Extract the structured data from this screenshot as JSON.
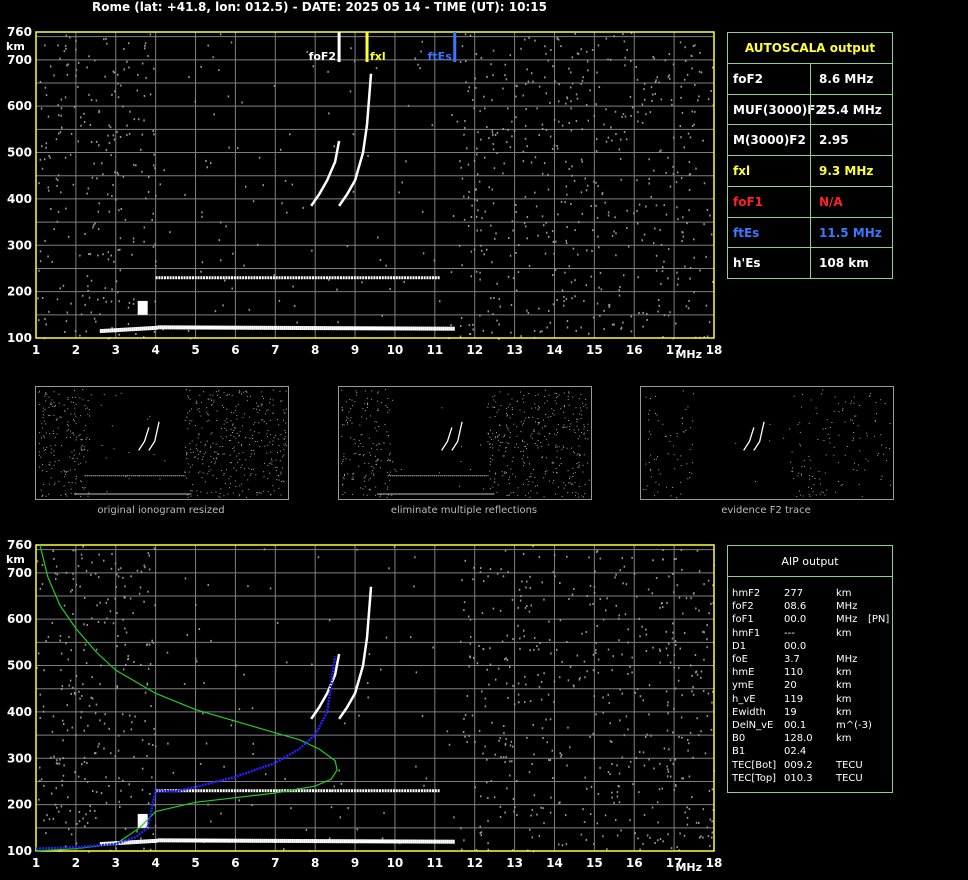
{
  "header": {
    "title": "Rome (lat: +41.8, lon: 012.5) - DATE: 2025 05 14 - TIME (UT): 10:15"
  },
  "colors": {
    "grid": "#7f7f7f",
    "axis_frame": "#ffff33",
    "trace": "#ffffff",
    "fof2": "#ffffff",
    "fxl": "#ffff33",
    "ftes": "#3a78ff",
    "panel_border": "#8fd08f",
    "profile": "#22cc22",
    "model_trace": "#2222ff"
  },
  "chart_data": [
    {
      "type": "scatter",
      "name_key": "autoscala-ionogram",
      "xlabel": "MHz",
      "ylabel": "km",
      "xlim": [
        1,
        18
      ],
      "ylim": [
        100,
        760
      ],
      "x_ticks": [
        "1",
        "2",
        "3",
        "4",
        "5",
        "6",
        "7",
        "8",
        "9",
        "10",
        "11",
        "12",
        "13",
        "14",
        "15",
        "16",
        "17",
        "18"
      ],
      "y_ticks": [
        "100",
        "200",
        "300",
        "400",
        "500",
        "600",
        "700",
        "760"
      ],
      "markers": [
        {
          "label": "foF2",
          "x": 8.6,
          "color": "#ffffff"
        },
        {
          "label": "fxl",
          "x": 9.3,
          "color": "#ffff33"
        },
        {
          "label": "ftEs",
          "x": 11.5,
          "color": "#3a78ff"
        }
      ],
      "traces": {
        "es_layer": {
          "x": [
            2.6,
            11.5
          ],
          "y": [
            115,
            125
          ]
        },
        "e_cusp": {
          "x": [
            3.55,
            3.8
          ],
          "y": [
            150,
            180
          ]
        },
        "f1_flat": {
          "x": [
            4.0,
            11.1
          ],
          "y": [
            230,
            230
          ]
        },
        "f2_ordinary": {
          "x": [
            7.9,
            8.1,
            8.3,
            8.5,
            8.6
          ],
          "y": [
            385,
            410,
            440,
            480,
            525
          ]
        },
        "f2_extraordinary": {
          "x": [
            8.6,
            8.8,
            9.0,
            9.2,
            9.3,
            9.4
          ],
          "y": [
            385,
            410,
            440,
            500,
            560,
            670
          ]
        }
      }
    },
    {
      "type": "scatter",
      "name_key": "aip-ionogram",
      "xlabel": "MHz",
      "ylabel": "km",
      "xlim": [
        1,
        18
      ],
      "ylim": [
        100,
        760
      ],
      "x_ticks": [
        "1",
        "2",
        "3",
        "4",
        "5",
        "6",
        "7",
        "8",
        "9",
        "10",
        "11",
        "12",
        "13",
        "14",
        "15",
        "16",
        "17",
        "18"
      ],
      "y_ticks": [
        "100",
        "200",
        "300",
        "400",
        "500",
        "600",
        "700",
        "760"
      ],
      "profile_curve": {
        "x": [
          1.1,
          1.3,
          1.6,
          2.0,
          2.5,
          3.0,
          4.0,
          5.0,
          6.0,
          7.0,
          7.6,
          8.1,
          8.5,
          8.55,
          8.4,
          8.0,
          7.0,
          6.0,
          5.0,
          4.0,
          3.6,
          3.0,
          2.0,
          1.0
        ],
        "y": [
          760,
          690,
          630,
          580,
          530,
          490,
          440,
          405,
          380,
          355,
          340,
          320,
          295,
          275,
          255,
          240,
          225,
          215,
          205,
          185,
          150,
          115,
          105,
          100
        ]
      },
      "model_trace": {
        "x": [
          1.0,
          2.0,
          3.0,
          3.5,
          3.8,
          4.0,
          4.5,
          5.0,
          6.0,
          7.0,
          7.6,
          8.0,
          8.3,
          8.5
        ],
        "y": [
          105,
          108,
          115,
          130,
          150,
          230,
          228,
          238,
          260,
          290,
          320,
          350,
          400,
          520
        ]
      }
    }
  ],
  "autoscala": {
    "title": "AUTOSCALA output",
    "rows": [
      {
        "label": "foF2",
        "value": "8.6 MHz",
        "color": "#ffffff"
      },
      {
        "label": "MUF(3000)F2",
        "value": "25.4 MHz",
        "color": "#ffffff"
      },
      {
        "label": "M(3000)F2",
        "value": "2.95",
        "color": "#ffffff"
      },
      {
        "label": "fxl",
        "value": "9.3 MHz",
        "color": "#ffff33"
      },
      {
        "label": "foF1",
        "value": "N/A",
        "color": "#ff2222"
      },
      {
        "label": "ftEs",
        "value": "11.5 MHz",
        "color": "#3a78ff"
      },
      {
        "label": "h'Es",
        "value": "108     km",
        "color": "#ffffff"
      }
    ]
  },
  "thumbnails": [
    {
      "caption": "original ionogram resized"
    },
    {
      "caption": "eliminate multiple reflections"
    },
    {
      "caption": "evidence F2 trace"
    }
  ],
  "aip": {
    "title": "AIP output",
    "rows": [
      {
        "k": "hmF2",
        "v": "277",
        "u": "km",
        "e": ""
      },
      {
        "k": "foF2",
        "v": "08.6",
        "u": "MHz",
        "e": ""
      },
      {
        "k": "foF1",
        "v": "00.0",
        "u": "MHz",
        "e": "[PN]"
      },
      {
        "k": "hmF1",
        "v": "---",
        "u": "km",
        "e": ""
      },
      {
        "k": "D1",
        "v": "00.0",
        "u": "",
        "e": ""
      },
      {
        "k": "foE",
        "v": "3.7",
        "u": "MHz",
        "e": ""
      },
      {
        "k": "hmE",
        "v": "110",
        "u": "km",
        "e": ""
      },
      {
        "k": "ymE",
        "v": "20",
        "u": "km",
        "e": ""
      },
      {
        "k": "h_vE",
        "v": "119",
        "u": "km",
        "e": ""
      },
      {
        "k": "Ewidth",
        "v": "19",
        "u": "km",
        "e": ""
      },
      {
        "k": "DelN_vE",
        "v": "00.1",
        "u": "m^(-3)",
        "e": ""
      },
      {
        "k": "B0",
        "v": "128.0",
        "u": "km",
        "e": ""
      },
      {
        "k": "B1",
        "v": "02.4",
        "u": "",
        "e": ""
      },
      {
        "k": "TEC[Bot]",
        "v": "009.2",
        "u": "TECU",
        "e": ""
      },
      {
        "k": "TEC[Top]",
        "v": "010.3",
        "u": "TECU",
        "e": ""
      }
    ]
  }
}
